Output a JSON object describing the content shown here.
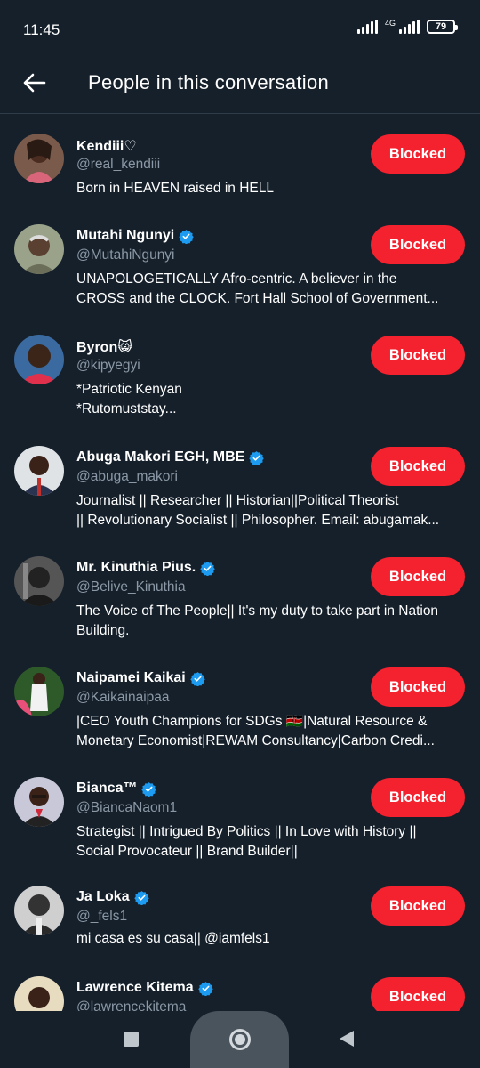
{
  "status_bar": {
    "time": "11:45",
    "network": "4G",
    "battery": "79"
  },
  "header": {
    "title": "People in this conversation"
  },
  "people": [
    {
      "name": "Kendiii♡",
      "handle": "@real_kendiii",
      "verified": false,
      "bio": [
        "Born in HEAVEN raised in HELL"
      ],
      "button": "Blocked"
    },
    {
      "name": "Mutahi Ngunyi",
      "handle": "@MutahiNgunyi",
      "verified": true,
      "bio": [
        "UNAPOLOGETICALLY Afro-centric. A believer in the",
        "CROSS and the CLOCK.   Fort Hall School of Government..."
      ],
      "button": "Blocked"
    },
    {
      "name": "Byron😸",
      "handle": "@kipyegyi",
      "verified": false,
      "bio": [
        "*Patriotic Kenyan",
        "*Rutomuststay..."
      ],
      "button": "Blocked"
    },
    {
      "name": "Abuga Makori EGH, MBE",
      "handle": "@abuga_makori",
      "verified": true,
      "bio": [
        "Journalist || Researcher || Historian||Political Theorist",
        "|| Revolutionary Socialist || Philosopher. Email: abugamak..."
      ],
      "button": "Blocked"
    },
    {
      "name": "Mr. Kinuthia Pius.",
      "handle": "@Belive_Kinuthia",
      "verified": true,
      "bio": [
        "The Voice of The People|| It's my duty to take part in Nation",
        "Building."
      ],
      "button": "Blocked"
    },
    {
      "name": "Naipamei Kaikai",
      "handle": "@Kaikainaipaa",
      "verified": true,
      "bio": [
        "|CEO Youth Champions for SDGs 🇰🇪|Natural Resource &",
        "Monetary Economist|REWAM Consultancy|Carbon Credi..."
      ],
      "button": "Blocked"
    },
    {
      "name": "Bianca™",
      "handle": "@BiancaNaom1",
      "verified": true,
      "bio": [
        "Strategist || Intrigued By Politics || In Love with History ||",
        "Social Provocateur || Brand Builder||"
      ],
      "button": "Blocked"
    },
    {
      "name": "Ja Loka",
      "handle": "@_fels1",
      "verified": true,
      "bio": [
        "mi casa es su casa|| @iamfels1"
      ],
      "button": "Blocked"
    },
    {
      "name": "Lawrence Kitema",
      "handle": "@lawrencekitema",
      "verified": true,
      "bio": [],
      "button": "Blocked"
    }
  ],
  "colors": {
    "background": "#15202b",
    "blocked": "#f4212e",
    "verified": "#1d9bf0",
    "muted": "#8b98a5"
  },
  "icons": {
    "back": "arrow-left-icon",
    "verified": "verified-badge-icon"
  }
}
